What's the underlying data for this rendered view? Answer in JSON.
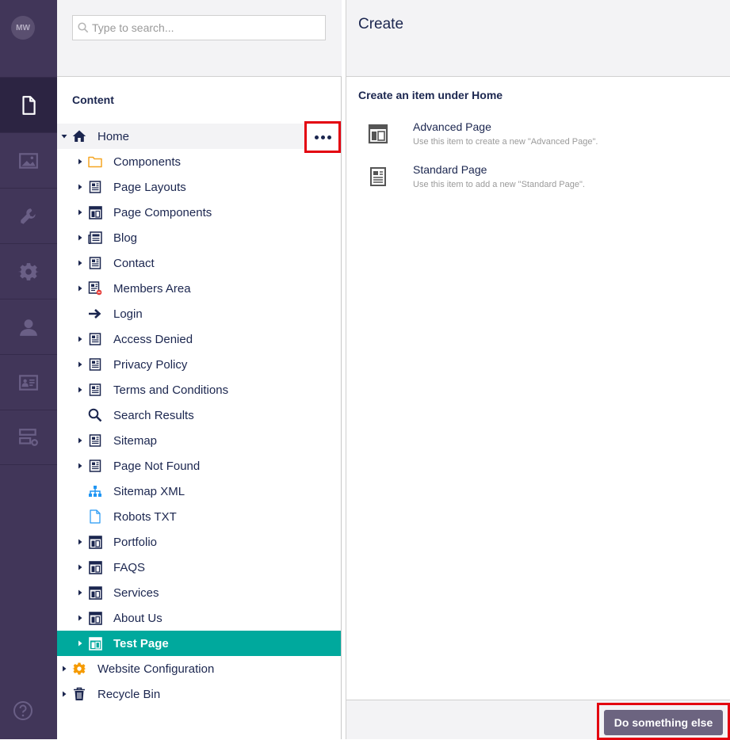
{
  "user": {
    "initials": "MW"
  },
  "rail": {
    "sections": [
      {
        "icon": "document-icon",
        "active": true
      },
      {
        "icon": "image-icon",
        "active": false
      },
      {
        "icon": "wrench-icon",
        "active": false
      },
      {
        "icon": "gear-icon",
        "active": false
      },
      {
        "icon": "user-icon",
        "active": false
      },
      {
        "icon": "member-card-icon",
        "active": false
      },
      {
        "icon": "forms-icon",
        "active": false
      }
    ],
    "help_icon": "help-icon"
  },
  "search": {
    "placeholder": "Type to search..."
  },
  "tree": {
    "title": "Content",
    "items": [
      {
        "label": "Home",
        "icon": "home-icon",
        "level": 0,
        "caret": "down"
      },
      {
        "label": "Components",
        "icon": "folder-icon",
        "level": 1,
        "caret": "right"
      },
      {
        "label": "Page Layouts",
        "icon": "standard-page-icon",
        "level": 1,
        "caret": "right"
      },
      {
        "label": "Page Components",
        "icon": "layout-icon",
        "level": 1,
        "caret": "right"
      },
      {
        "label": "Blog",
        "icon": "newspaper-icon",
        "level": 1,
        "caret": "right"
      },
      {
        "label": "Contact",
        "icon": "standard-page-icon",
        "level": 1,
        "caret": "right"
      },
      {
        "label": "Members Area",
        "icon": "restricted-page-icon",
        "level": 1,
        "caret": "right"
      },
      {
        "label": "Login",
        "icon": "arrow-right-icon",
        "level": 1,
        "caret": ""
      },
      {
        "label": "Access Denied",
        "icon": "standard-page-icon",
        "level": 1,
        "caret": "right"
      },
      {
        "label": "Privacy Policy",
        "icon": "standard-page-icon",
        "level": 1,
        "caret": "right"
      },
      {
        "label": "Terms and Conditions",
        "icon": "standard-page-icon",
        "level": 1,
        "caret": "right"
      },
      {
        "label": "Search Results",
        "icon": "search-icon",
        "level": 1,
        "caret": ""
      },
      {
        "label": "Sitemap",
        "icon": "standard-page-icon",
        "level": 1,
        "caret": "right"
      },
      {
        "label": "Page Not Found",
        "icon": "standard-page-icon",
        "level": 1,
        "caret": "right"
      },
      {
        "label": "Sitemap XML",
        "icon": "sitemap-icon",
        "level": 1,
        "caret": ""
      },
      {
        "label": "Robots TXT",
        "icon": "text-file-icon",
        "level": 1,
        "caret": ""
      },
      {
        "label": "Portfolio",
        "icon": "layout-icon",
        "level": 1,
        "caret": "right"
      },
      {
        "label": "FAQS",
        "icon": "layout-icon",
        "level": 1,
        "caret": "right"
      },
      {
        "label": "Services",
        "icon": "layout-icon",
        "level": 1,
        "caret": "right"
      },
      {
        "label": "About Us",
        "icon": "layout-icon",
        "level": 1,
        "caret": "right"
      },
      {
        "label": "Test Page",
        "icon": "layout-icon",
        "level": 1,
        "caret": "right",
        "selected": true
      },
      {
        "label": "Website Configuration",
        "icon": "gear-icon",
        "level": 0,
        "caret": "right"
      },
      {
        "label": "Recycle Bin",
        "icon": "trash-icon",
        "level": 0,
        "caret": "right"
      }
    ]
  },
  "create_panel": {
    "title": "Create",
    "subtitle": "Create an item under Home",
    "doctypes": [
      {
        "name": "Advanced Page",
        "description": "Use this item to create a new \"Advanced Page\".",
        "icon": "layout-icon"
      },
      {
        "name": "Standard Page",
        "description": "Use this item to add a new \"Standard Page\".",
        "icon": "standard-page-icon"
      }
    ],
    "action_label": "Do something else"
  },
  "colors": {
    "rail": "#413659",
    "rail_active": "#2c2442",
    "selected": "#00a99d",
    "highlight": "#e3000f",
    "folder": "#f5a623",
    "gear": "#f59a00",
    "sitemap": "#2196f3",
    "action_button": "#6c6480"
  }
}
